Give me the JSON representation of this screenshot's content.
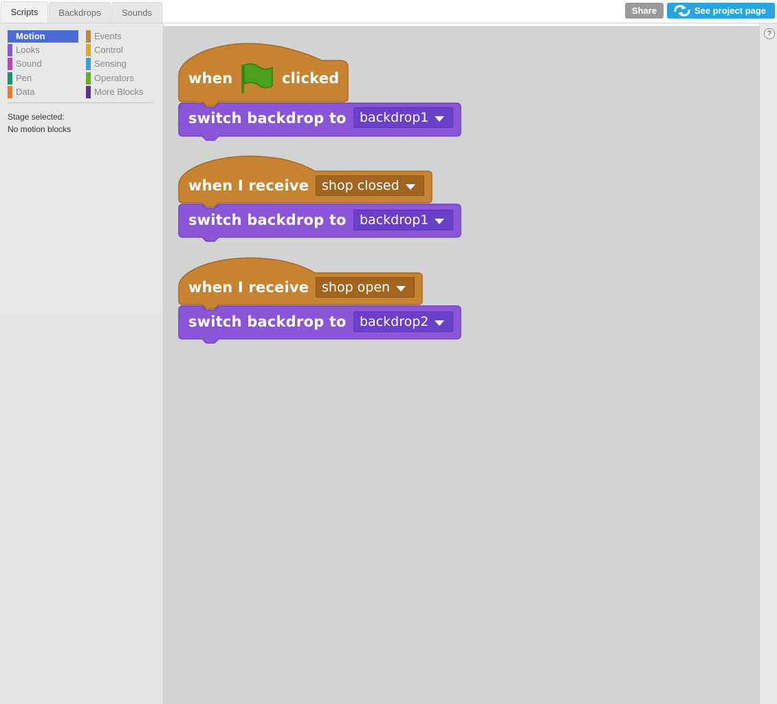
{
  "tabs": [
    {
      "label": "Scripts",
      "active": true
    },
    {
      "label": "Backdrops",
      "active": false
    },
    {
      "label": "Sounds",
      "active": false
    }
  ],
  "header": {
    "share_label": "Share",
    "project_page_label": "See project page",
    "project_page_icon": "remix-arrows-icon"
  },
  "palette": {
    "categories": [
      {
        "label": "Motion",
        "color": "#4a6cd4",
        "selected": true
      },
      {
        "label": "Looks",
        "color": "#8a55d7"
      },
      {
        "label": "Sound",
        "color": "#bb42c3"
      },
      {
        "label": "Pen",
        "color": "#0e9a6c"
      },
      {
        "label": "Data",
        "color": "#ee7d16"
      },
      {
        "label": "Events",
        "color": "#c88330"
      },
      {
        "label": "Control",
        "color": "#e1a91a"
      },
      {
        "label": "Sensing",
        "color": "#2ca5e2"
      },
      {
        "label": "Operators",
        "color": "#5cb712"
      },
      {
        "label": "More Blocks",
        "color": "#632d99"
      }
    ],
    "stage_note_line1": "Stage selected:",
    "stage_note_line2": "No motion blocks"
  },
  "colors": {
    "events_block": "#c88330",
    "looks_block": "#8a55d7"
  },
  "scripts": [
    {
      "hat": {
        "word1": "when",
        "icon": "green-flag-icon",
        "word2": "clicked"
      },
      "command": {
        "text": "switch backdrop to",
        "value": "backdrop1"
      }
    },
    {
      "hat": {
        "text": "when I receive",
        "value": "shop closed"
      },
      "command": {
        "text": "switch backdrop to",
        "value": "backdrop1"
      }
    },
    {
      "hat": {
        "text": "when I receive",
        "value": "shop open"
      },
      "command": {
        "text": "switch backdrop to",
        "value": "backdrop2"
      }
    }
  ],
  "help_label": "?"
}
